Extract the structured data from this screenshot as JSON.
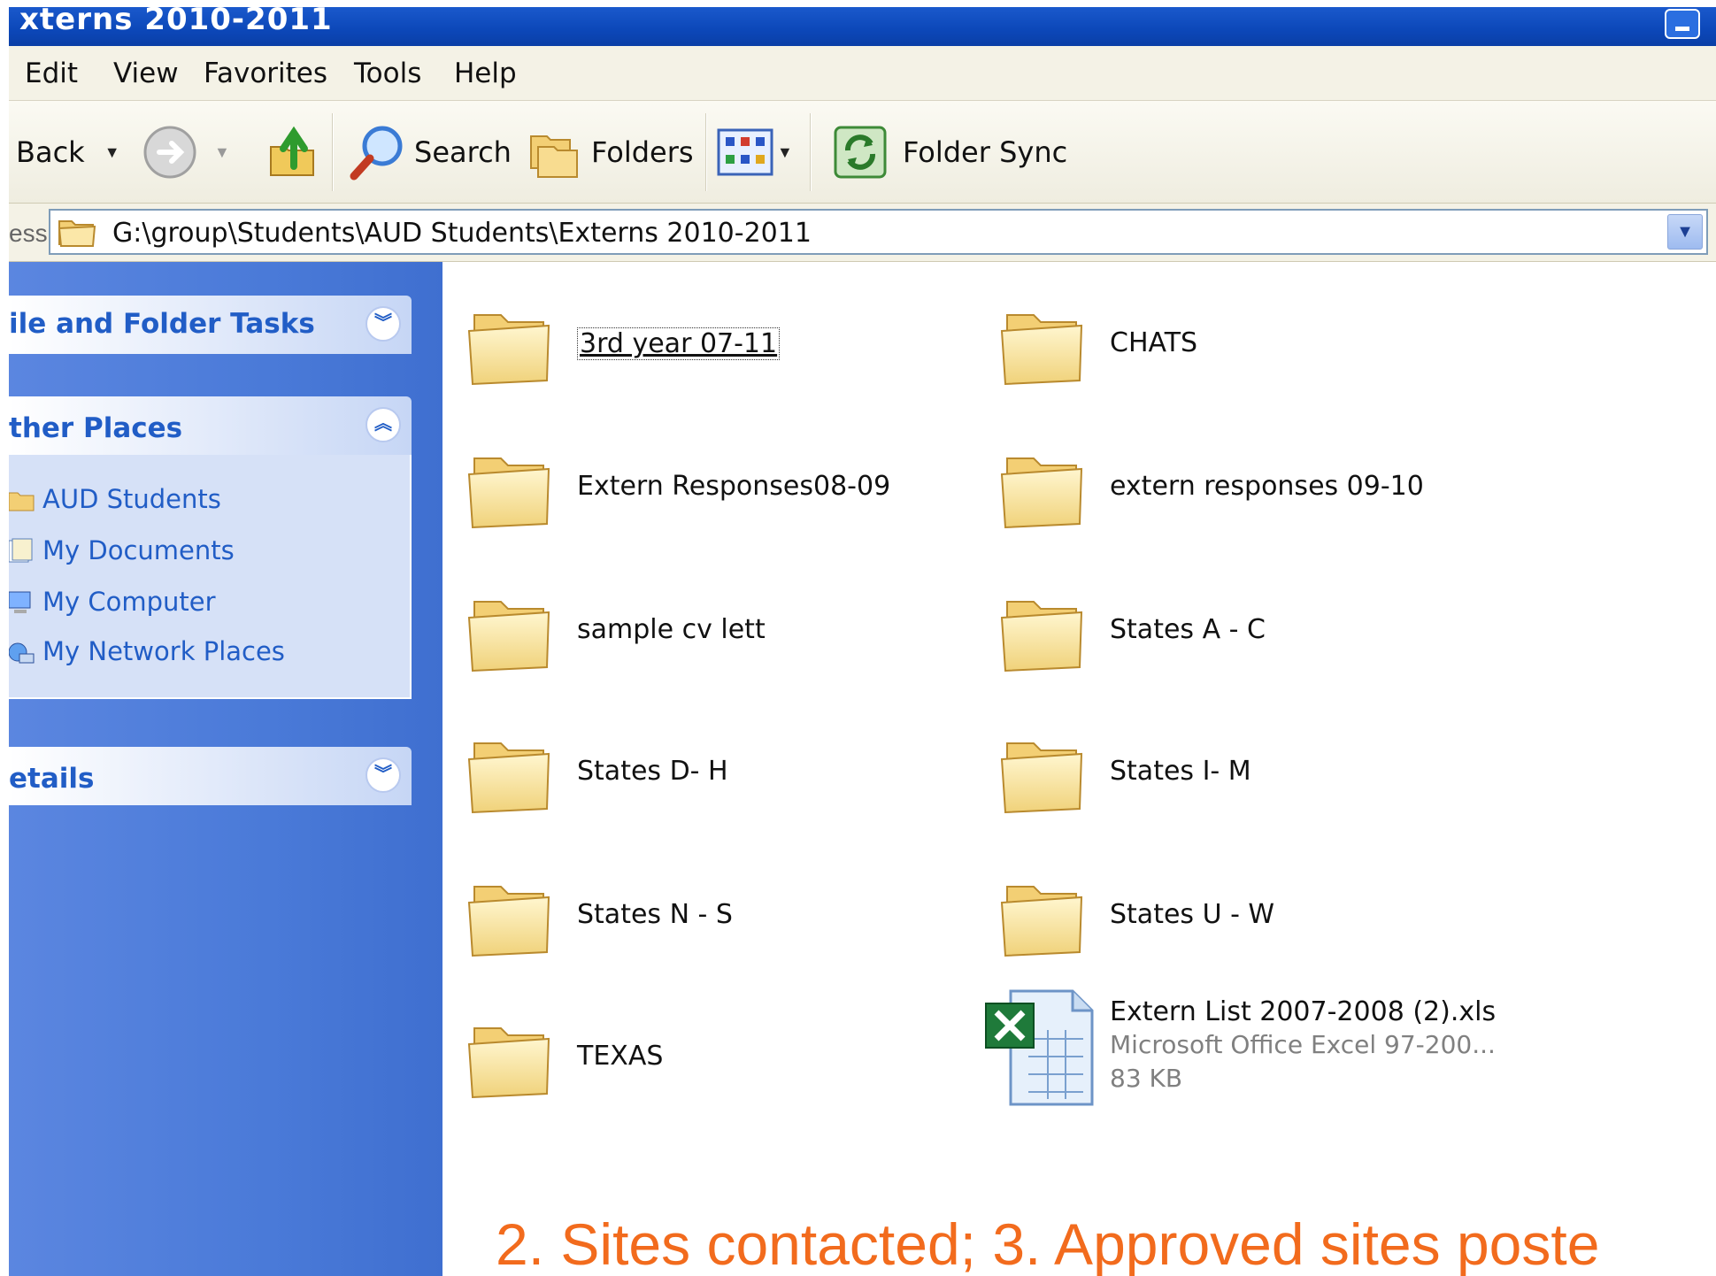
{
  "window": {
    "title": "xterns 2010-2011"
  },
  "menu": [
    "Edit",
    "View",
    "Favorites",
    "Tools",
    "Help"
  ],
  "toolbar": {
    "back_label": "Back",
    "search_label": "Search",
    "folders_label": "Folders",
    "foldersync_label": "Folder Sync"
  },
  "address": {
    "label": "ess",
    "path": "G:\\group\\Students\\AUD Students\\Externs 2010-2011"
  },
  "taskpane": {
    "file_folder_tasks": "ile and Folder Tasks",
    "other_places": "ther Places",
    "places": [
      "AUD Students",
      "My Documents",
      "My Computer",
      "My Network Places"
    ],
    "details": "etails"
  },
  "items": [
    {
      "name": "3rd year 07-11"
    },
    {
      "name": "CHATS"
    },
    {
      "name": "Extern Responses08-09"
    },
    {
      "name": "extern responses 09-10"
    },
    {
      "name": "sample cv lett"
    },
    {
      "name": "States A - C"
    },
    {
      "name": "States D- H"
    },
    {
      "name": "States I- M"
    },
    {
      "name": "States N - S"
    },
    {
      "name": "States U - W"
    },
    {
      "name": "TEXAS"
    }
  ],
  "file": {
    "name": "Extern List 2007-2008 (2).xls",
    "type": "Microsoft Office Excel 97-200...",
    "size": "83 KB"
  },
  "caption": "2.  Sites contacted;  3.  Approved sites poste",
  "colors": {
    "accent": "#215dc6",
    "caption": "#f26b1d",
    "titlebar": "#0c47b8"
  }
}
